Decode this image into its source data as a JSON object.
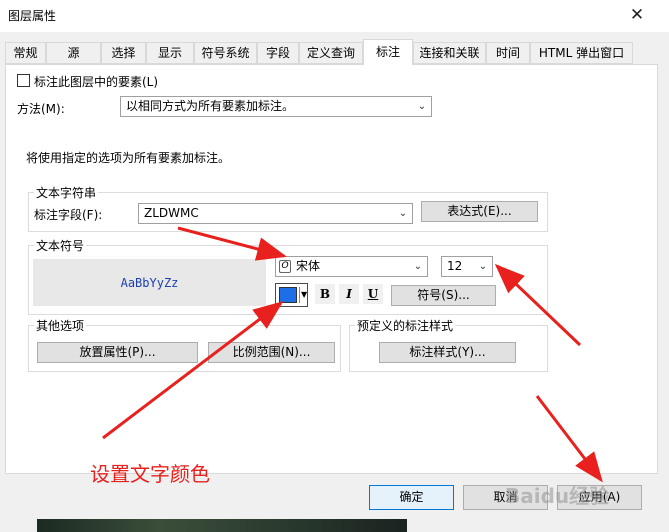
{
  "window": {
    "title": "图层属性",
    "close_glyph": "✕"
  },
  "tabs": [
    {
      "label": "常规"
    },
    {
      "label": "源"
    },
    {
      "label": "选择"
    },
    {
      "label": "显示"
    },
    {
      "label": "符号系统"
    },
    {
      "label": "字段"
    },
    {
      "label": "定义查询"
    },
    {
      "label": "标注"
    },
    {
      "label": "连接和关联"
    },
    {
      "label": "时间"
    },
    {
      "label": "HTML 弹出窗口"
    }
  ],
  "active_tab": "标注",
  "label_features": {
    "label": "标注此图层中的要素(L)",
    "checked": false
  },
  "method": {
    "label": "方法(M):",
    "value": "以相同方式为所有要素加标注。"
  },
  "info_text": "将使用指定的选项为所有要素加标注。",
  "text_string": {
    "group_title": "文本字符串",
    "field_label": "标注字段(F):",
    "field_value": "ZLDWMC",
    "expression_button": "表达式(E)..."
  },
  "text_symbol": {
    "group_title": "文本符号",
    "preview_text": "AaBbYyZz",
    "font_name": "宋体",
    "font_size": "12",
    "color": "#1e6ee8",
    "bold": "B",
    "italic": "I",
    "underline": "U",
    "symbol_button": "符号(S)..."
  },
  "other_options": {
    "group_title": "其他选项",
    "placement_button": "放置属性(P)...",
    "scale_button": "比例范围(N)..."
  },
  "predefined": {
    "group_title": "预定义的标注样式",
    "style_button": "标注样式(Y)..."
  },
  "footer": {
    "ok": "确定",
    "cancel": "取消",
    "apply": "应用(A)"
  },
  "annotation": {
    "text": "设置文字颜色",
    "color": "#e8211e"
  },
  "watermark": "Baidu经验"
}
